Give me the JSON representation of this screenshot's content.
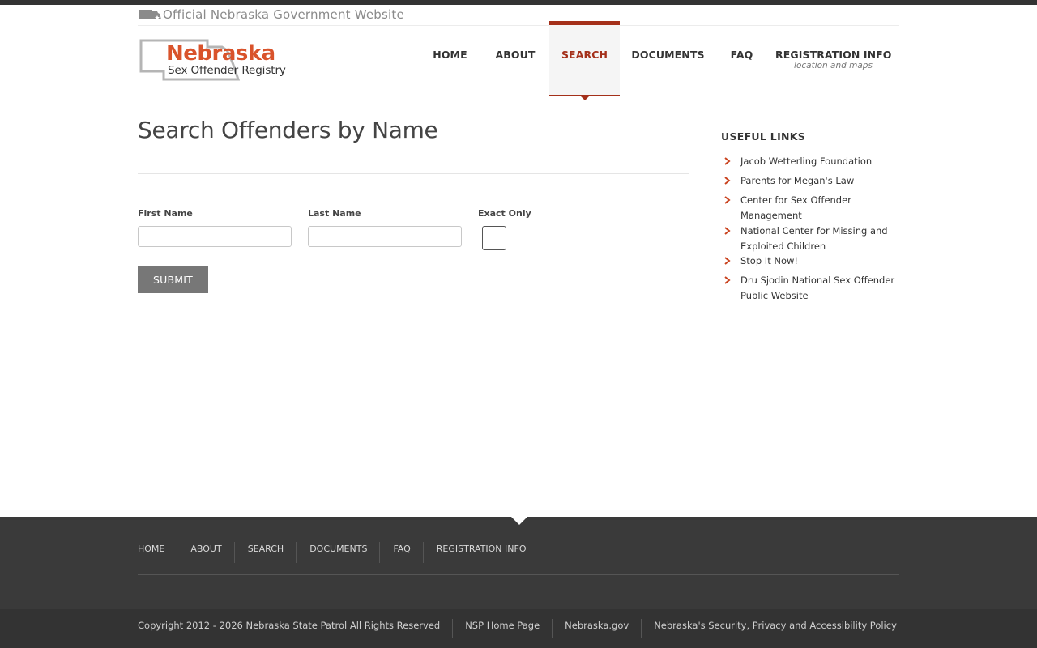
{
  "official_banner": {
    "text": "Official Nebraska Government Website",
    "icon": "nebraska-state-icon"
  },
  "logo": {
    "title": "Nebraska",
    "subtitle": "Sex Offender Registry",
    "brand_color": "#d9532b"
  },
  "nav": {
    "items": [
      {
        "label": "HOME",
        "sub": ""
      },
      {
        "label": "ABOUT",
        "sub": ""
      },
      {
        "label": "SEARCH",
        "sub": "",
        "active": true
      },
      {
        "label": "DOCUMENTS",
        "sub": ""
      },
      {
        "label": "FAQ",
        "sub": ""
      },
      {
        "label": "REGISTRATION INFO",
        "sub": "location and maps"
      }
    ],
    "active_color": "#a4301a"
  },
  "main": {
    "title": "Search Offenders by Name",
    "form": {
      "first_name_label": "First Name",
      "first_name_value": "",
      "last_name_label": "Last Name",
      "last_name_value": "",
      "exact_only_label": "Exact Only",
      "exact_only_checked": false,
      "submit_label": "SUBMIT"
    }
  },
  "sidebar": {
    "title": "USEFUL LINKS",
    "links": [
      "Jacob Wetterling Foundation",
      "Parents for Megan's Law",
      "Center for Sex Offender Management",
      "National Center for Missing and Exploited Children",
      "Stop It Now!",
      "Dru Sjodin National Sex Offender Public Website"
    ],
    "icon": "chevron-right-icon"
  },
  "footer": {
    "nav": [
      "HOME",
      "ABOUT",
      "SEARCH",
      "DOCUMENTS",
      "FAQ",
      "REGISTRATION INFO"
    ],
    "copyright": "Copyright 2012 - 2026 Nebraska State Patrol All Rights Reserved",
    "links": [
      "NSP Home Page",
      "Nebraska.gov",
      "Nebraska's Security, Privacy and Accessibility Policy"
    ]
  }
}
